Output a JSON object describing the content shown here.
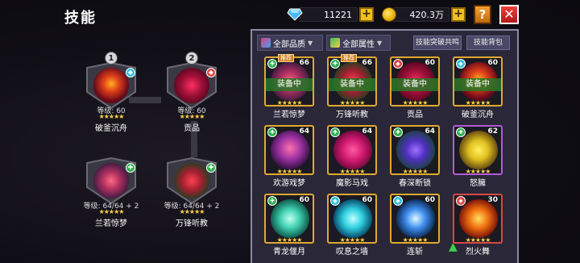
{
  "header": {
    "title": "技能",
    "gems": "11221",
    "gold": "420.3万",
    "plus_label": "+",
    "help_label": "?",
    "close_label": "✕"
  },
  "equipped": [
    {
      "num": "1",
      "level": "等级: 60",
      "stars": "★★★★★",
      "name": "破釜沉舟",
      "badge_color": "#30c0e0",
      "badge": "◆",
      "orb": "radial-gradient(circle at 50% 45%, #ffb020 0%, #e0401a 30%, #6a0a1a 65%, #2a0508 100%)"
    },
    {
      "num": "2",
      "level": "等级: 60",
      "stars": "★★★★★",
      "name": "贡品",
      "badge_color": "#e04040",
      "badge": "◆",
      "orb": "radial-gradient(circle at 50% 50%, #ff3060 0%, #a0103a 40%, #50051a 80%, #1a0208 100%)"
    },
    {
      "num": "",
      "level": "等级: 64/64 + 2",
      "stars": "★★★★★",
      "name": "兰若惊梦",
      "badge_color": "#30b050",
      "badge": "✚",
      "orb": "radial-gradient(circle at 50% 50%, #ff6a80 0%, #b03060 35%, #3a1a40 75%, #0f0a18 100%)"
    },
    {
      "num": "",
      "level": "等级: 64/64 + 2",
      "stars": "★★★★★",
      "name": "万锋听教",
      "badge_color": "#30b050",
      "badge": "✚",
      "orb": "radial-gradient(circle at 50% 50%, #ff4050 0%, #a02030 40%, #204020 75%, #0a140a 100%)"
    }
  ],
  "filters": {
    "quality": "全部品质",
    "attribute": "全部属性",
    "resonance_button": "技能突破共鸣",
    "bag_button": "技能背包"
  },
  "cards": [
    {
      "name": "兰若惊梦",
      "level": "66",
      "stars": "★★★★★",
      "equipped": "装备中",
      "tag": "推荐",
      "frame": "",
      "badge_color": "#30b050",
      "badge": "✚",
      "orb": "radial-gradient(circle at 50% 50%, #ff6a80 0%, #b03060 35%, #3a1a40 75%, #0f0a18 100%)"
    },
    {
      "name": "万锋听教",
      "level": "66",
      "stars": "★★★★★",
      "equipped": "装备中",
      "tag": "推荐",
      "frame": "",
      "badge_color": "#30b050",
      "badge": "✚",
      "orb": "radial-gradient(circle at 50% 50%, #ff4050 0%, #a02030 40%, #204020 75%, #0a140a 100%)"
    },
    {
      "name": "贡品",
      "level": "60",
      "stars": "★★★★★",
      "equipped": "装备中",
      "tag": "",
      "frame": "",
      "badge_color": "#e04040",
      "badge": "◆",
      "orb": "radial-gradient(circle at 50% 50%, #ff3060 0%, #a0103a 40%, #50051a 80%, #1a0208 100%)"
    },
    {
      "name": "破釜沉舟",
      "level": "60",
      "stars": "★★★★★",
      "equipped": "装备中",
      "tag": "",
      "frame": "",
      "badge_color": "#30c0e0",
      "badge": "◆",
      "orb": "radial-gradient(circle at 50% 45%, #ffb020 0%, #e0401a 30%, #6a0a1a 65%, #2a0508 100%)"
    },
    {
      "name": "欢游戏梦",
      "level": "64",
      "stars": "★★★★★",
      "equipped": "",
      "tag": "",
      "frame": "",
      "badge_color": "#30b050",
      "badge": "✚",
      "orb": "radial-gradient(circle at 50% 45%, #ff70b0 0%, #9a30a0 40%, #301040 75%, #100818 100%)"
    },
    {
      "name": "魔影马戏",
      "level": "64",
      "stars": "★★★★★",
      "equipped": "",
      "tag": "",
      "frame": "",
      "badge_color": "#30b050",
      "badge": "✚",
      "orb": "radial-gradient(circle at 50% 50%, #ff5aa0 0%, #d01870 40%, #5a0830 80%, #1a0210 100%)"
    },
    {
      "name": "春深断锁",
      "level": "64",
      "stars": "★★★★★",
      "equipped": "",
      "tag": "",
      "frame": "",
      "badge_color": "#30b050",
      "badge": "✚",
      "orb": "radial-gradient(circle at 50% 50%, #a070ff 0%, #5030c0 35%, #204050 70%, #081018 100%)"
    },
    {
      "name": "怒臃",
      "level": "62",
      "stars": "★★★★★",
      "equipped": "",
      "tag": "",
      "frame": "purple",
      "badge_color": "#30b050",
      "badge": "✚",
      "orb": "radial-gradient(circle at 50% 50%, #fff060 0%, #e0c020 35%, #6a5010 70%, #1a1408 100%)"
    },
    {
      "name": "青龙偃月",
      "level": "60",
      "stars": "★★★★★",
      "equipped": "",
      "tag": "",
      "frame": "",
      "badge_color": "#30b050",
      "badge": "✚",
      "orb": "radial-gradient(circle at 50% 50%, #c0fff0 0%, #40d0b0 35%, #106050 70%, #041a16 100%)"
    },
    {
      "name": "叹息之墙",
      "level": "60",
      "stars": "★★★★★",
      "equipped": "",
      "tag": "",
      "frame": "",
      "badge_color": "#30c0e0",
      "badge": "◆",
      "orb": "radial-gradient(circle at 50% 50%, #c0ffff 0%, #30d0e0 35%, #0a5070 70%, #041420 100%)"
    },
    {
      "name": "连斩",
      "level": "60",
      "stars": "★★★★★",
      "equipped": "",
      "tag": "",
      "frame": "",
      "badge_color": "#30c0e0",
      "badge": "◆",
      "orb": "radial-gradient(circle at 50% 50%, #e0f8ff 0%, #4090f0 35%, #103060 70%, #040a1a 100%)"
    },
    {
      "name": "烈火舞",
      "level": "30",
      "stars": "★★★★★",
      "equipped": "",
      "tag": "",
      "frame": "red",
      "badge_color": "#e04040",
      "badge": "◆",
      "orb": "radial-gradient(circle at 50% 50%, #ffe060 0%, #f07010 35%, #801808 70%, #200604 100%)"
    }
  ]
}
